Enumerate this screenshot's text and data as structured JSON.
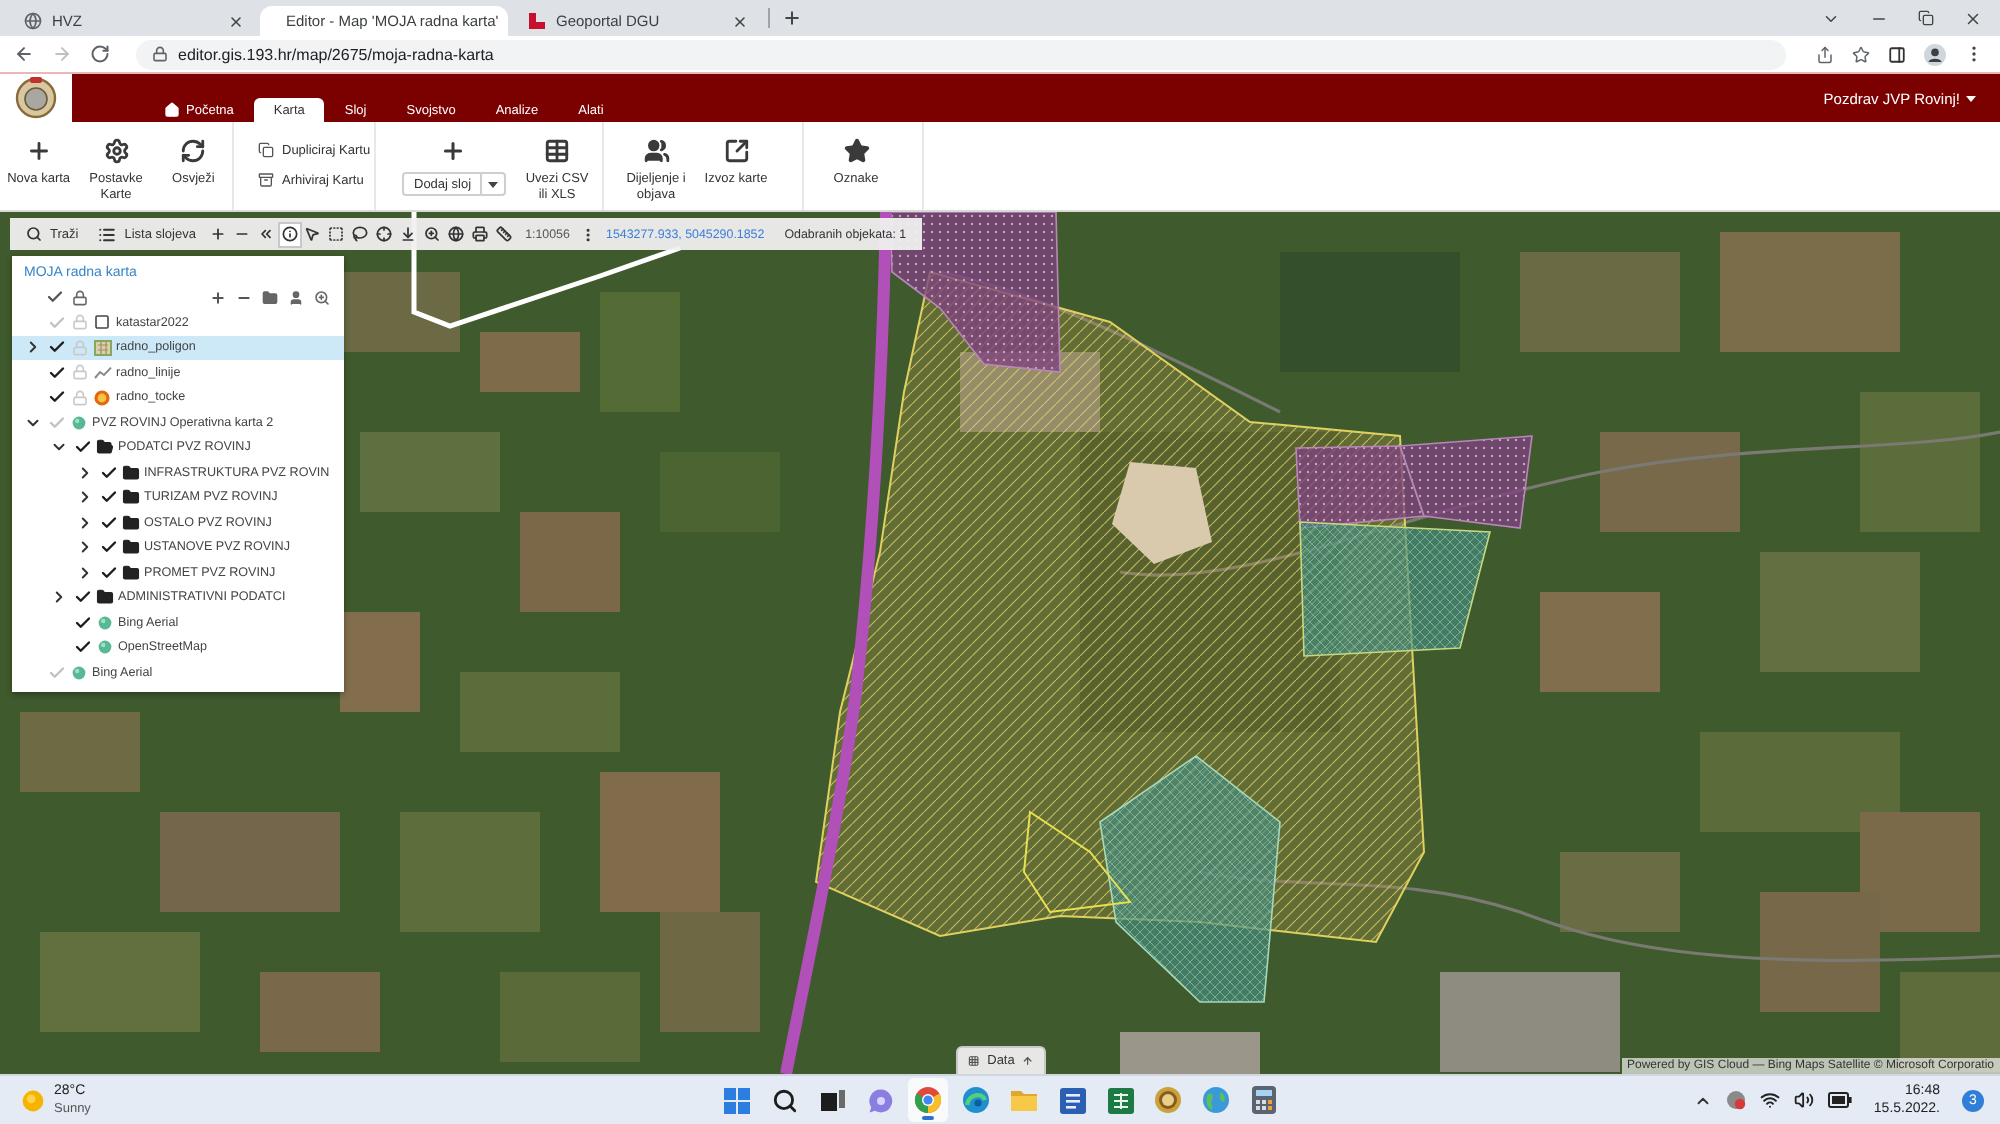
{
  "browser": {
    "tabs": [
      {
        "title": "HVZ",
        "selected": false
      },
      {
        "title": "Editor - Map 'MOJA radna karta'",
        "selected": true
      },
      {
        "title": "Geoportal DGU",
        "selected": false
      }
    ],
    "url": "editor.gis.193.hr/map/2675/moja-radna-karta"
  },
  "header": {
    "tabs": [
      {
        "label": "Početna",
        "selected": false
      },
      {
        "label": "Karta",
        "selected": true
      },
      {
        "label": "Sloj",
        "selected": false
      },
      {
        "label": "Svojstvo",
        "selected": false
      },
      {
        "label": "Analize",
        "selected": false
      },
      {
        "label": "Alati",
        "selected": false
      }
    ],
    "user_menu": "Pozdrav JVP Rovinj!"
  },
  "ribbon": {
    "groups": [
      {
        "items": [
          {
            "kind": "large",
            "label": "Nova karta"
          },
          {
            "kind": "large",
            "label": "Postavke Karte"
          },
          {
            "kind": "large",
            "label": "Osvježi"
          }
        ]
      },
      {
        "items": [
          {
            "kind": "small",
            "label": "Dupliciraj Kartu"
          },
          {
            "kind": "small",
            "label": "Arhiviraj Kartu"
          }
        ]
      },
      {
        "items": [
          {
            "kind": "dropdown",
            "label": "Dodaj sloj"
          },
          {
            "kind": "large",
            "label": "Uvezi CSV ili XLS"
          }
        ]
      },
      {
        "items": [
          {
            "kind": "large",
            "label": "Dijeljenje i objava"
          },
          {
            "kind": "large",
            "label": "Izvoz karte"
          }
        ]
      },
      {
        "items": [
          {
            "kind": "large",
            "label": "Oznake"
          }
        ]
      }
    ]
  },
  "map_toolbar": {
    "search": "Traži",
    "layer_list": "Lista slojeva",
    "tools": [
      {
        "selected": false
      },
      {
        "selected": false
      },
      {
        "selected": false
      },
      {
        "selected": true
      },
      {
        "selected": false
      },
      {
        "selected": false
      },
      {
        "selected": false
      },
      {
        "selected": false
      },
      {
        "selected": false
      },
      {
        "selected": false
      },
      {
        "selected": false
      },
      {
        "selected": false
      },
      {
        "selected": false
      }
    ],
    "scale": "1:10056",
    "coordinates": "1543277.933, 5045290.1852",
    "selection": "Odabranih objekata: 1"
  },
  "layer_panel": {
    "title": "MOJA radna karta",
    "layers": [
      {
        "label": "katastar2022",
        "kind": "layer",
        "checked": false,
        "selected": false
      },
      {
        "label": "radno_poligon",
        "kind": "polygon",
        "checked": true,
        "selected": true,
        "expanded": false
      },
      {
        "label": "radno_linije",
        "kind": "line",
        "checked": true,
        "selected": false
      },
      {
        "label": "radno_tocke",
        "kind": "point",
        "checked": true,
        "selected": false
      },
      {
        "label": "PVZ ROVINJ Operativna karta 2",
        "kind": "map",
        "checked": false,
        "selected": false,
        "expanded": true,
        "children": [
          {
            "label": "PODATCI PVZ ROVINJ",
            "kind": "folder",
            "checked": true,
            "selected": false,
            "expanded": true,
            "children": [
              {
                "label": "INFRASTRUKTURA PVZ ROVIN",
                "kind": "folder",
                "checked": true,
                "selected": false,
                "expanded": false
              },
              {
                "label": "TURIZAM PVZ ROVINJ",
                "kind": "folder",
                "checked": true,
                "selected": false,
                "expanded": false
              },
              {
                "label": "OSTALO PVZ ROVINJ",
                "kind": "folder",
                "checked": true,
                "selected": false,
                "expanded": false
              },
              {
                "label": "USTANOVE PVZ ROVINJ",
                "kind": "folder",
                "checked": true,
                "selected": false,
                "expanded": false
              },
              {
                "label": "PROMET PVZ ROVINJ",
                "kind": "folder",
                "checked": true,
                "selected": false,
                "expanded": false
              }
            ]
          },
          {
            "label": "ADMINISTRATIVNI PODATCI",
            "kind": "folder",
            "checked": true,
            "selected": false,
            "expanded": false
          },
          {
            "label": "Bing Aerial",
            "kind": "map",
            "checked": true,
            "selected": false
          },
          {
            "label": "OpenStreetMap",
            "kind": "map",
            "checked": true,
            "selected": false
          }
        ]
      },
      {
        "label": "Bing Aerial",
        "kind": "map",
        "checked": false,
        "selected": false
      }
    ]
  },
  "data_tab": {
    "label": "Data"
  },
  "attribution": "Powered by GIS Cloud — Bing Maps Satellite © Microsoft Corporatio",
  "taskbar": {
    "weather": {
      "temperature": "28°C",
      "condition": "Sunny"
    },
    "apps": [
      {
        "kind": "start",
        "active": false
      },
      {
        "kind": "search",
        "active": false
      },
      {
        "kind": "task-view",
        "active": false
      },
      {
        "kind": "chat",
        "active": false
      },
      {
        "kind": "browser",
        "active": true
      },
      {
        "kind": "browser-alt",
        "active": false
      },
      {
        "kind": "files",
        "active": false
      },
      {
        "kind": "document",
        "active": false
      },
      {
        "kind": "spreadsheet",
        "active": false
      },
      {
        "kind": "emblem",
        "active": false
      },
      {
        "kind": "globe",
        "active": false
      },
      {
        "kind": "calculator",
        "active": false
      }
    ],
    "time": "16:48",
    "date": "15.5.2022.",
    "notifications": "3"
  }
}
